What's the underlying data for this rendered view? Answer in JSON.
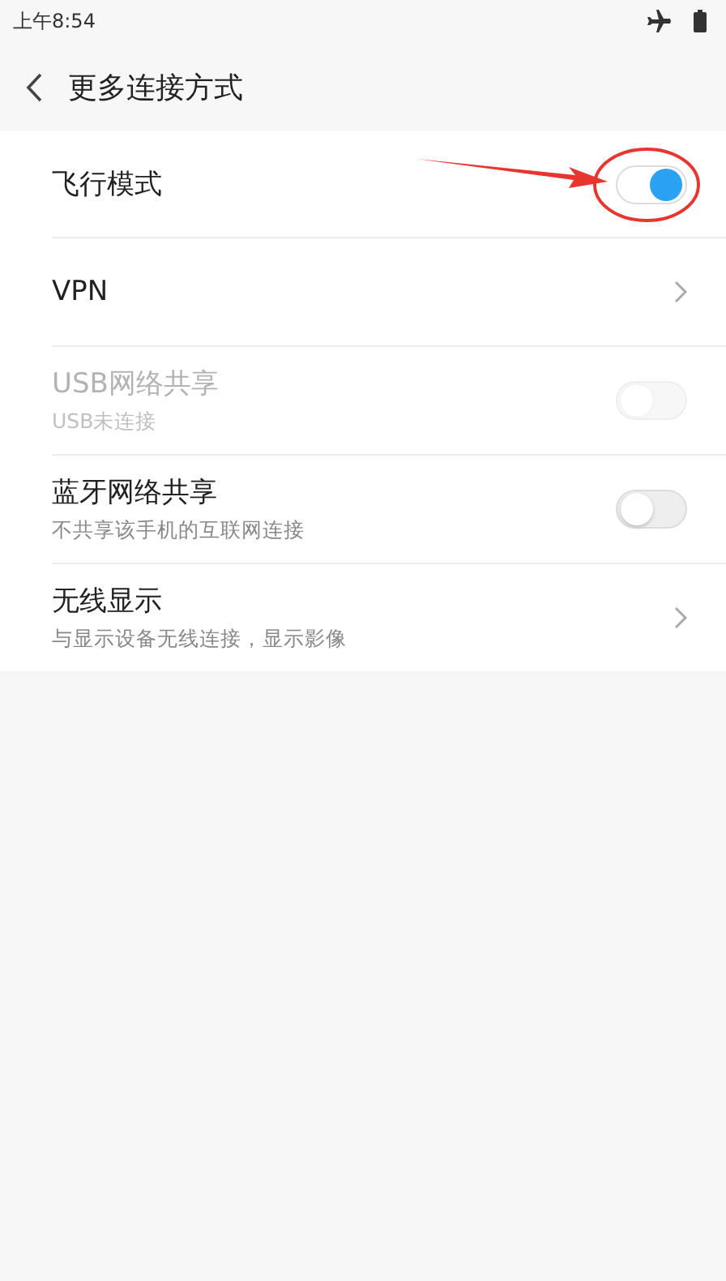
{
  "status_bar": {
    "time": "上午8:54"
  },
  "header": {
    "title": "更多连接方式"
  },
  "rows": [
    {
      "kind": "switch",
      "title": "飞行模式",
      "on": true,
      "disabled": false
    },
    {
      "kind": "link",
      "title": "VPN",
      "disabled": false
    },
    {
      "kind": "switch",
      "title": "USB网络共享",
      "subtitle": "USB未连接",
      "on": false,
      "disabled": true
    },
    {
      "kind": "switch",
      "title": "蓝牙网络共享",
      "subtitle": "不共享该手机的互联网连接",
      "on": false,
      "disabled": false
    },
    {
      "kind": "link",
      "title": "无线显示",
      "subtitle": "与显示设备无线连接，显示影像",
      "disabled": false
    }
  ]
}
